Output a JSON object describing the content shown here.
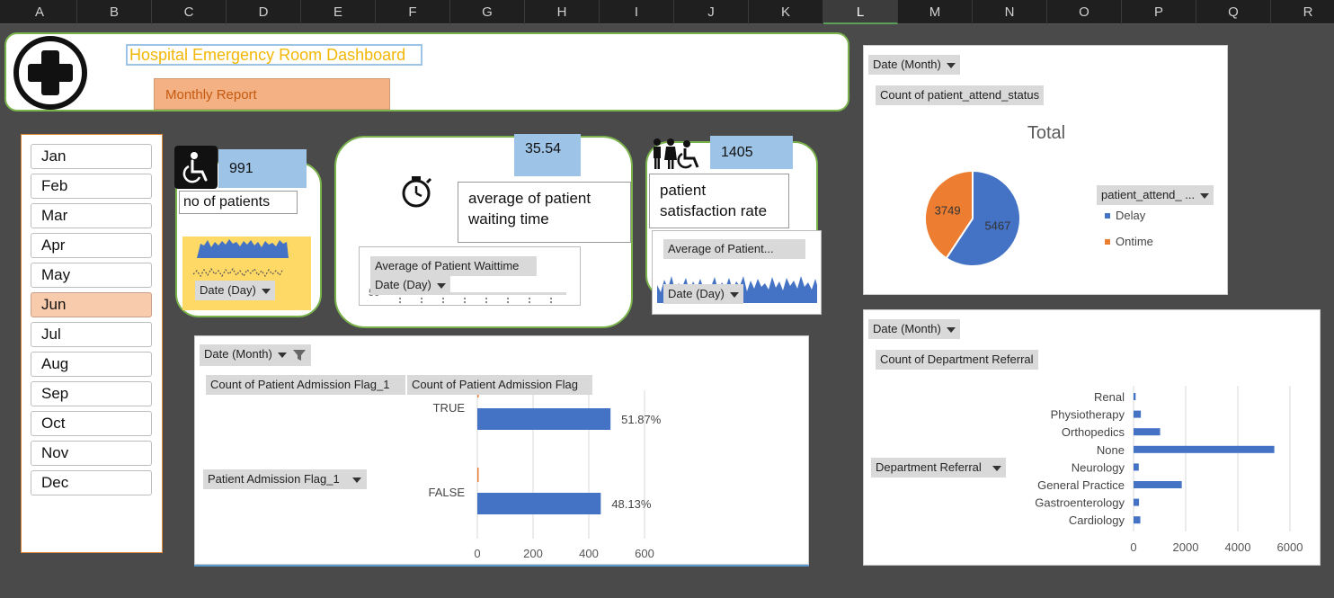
{
  "sheet": {
    "columns": [
      "A",
      "B",
      "C",
      "D",
      "E",
      "F",
      "G",
      "H",
      "I",
      "J",
      "K",
      "L",
      "M",
      "N",
      "O",
      "P",
      "Q",
      "R"
    ],
    "selected_column": "L"
  },
  "header": {
    "title": "Hospital Emergency Room Dashboard",
    "subtitle": "Monthly Report",
    "icon": "medical-cross-icon",
    "title_color": "#f2b705",
    "subtitle_bg": "#f4b183"
  },
  "slicer": {
    "months": [
      "Jan",
      "Feb",
      "Mar",
      "Apr",
      "May",
      "Jun",
      "Jul",
      "Aug",
      "Sep",
      "Oct",
      "Nov",
      "Dec"
    ],
    "selected": "Jun"
  },
  "kpis": {
    "patients": {
      "value": "991",
      "label": "no of patients",
      "filter": "Date (Day)",
      "icon": "wheelchair-icon"
    },
    "wait_time": {
      "value": "35.54",
      "label": "average of patient waiting time",
      "field": "Average of Patient Waittime",
      "filter": "Date (Day)",
      "axis_tick": "50",
      "icon": "stopwatch-icon"
    },
    "satisfaction": {
      "value": "1405",
      "label": "patient satisfaction rate",
      "field": "Average of Patient...",
      "filter": "Date (Day)",
      "icon": "people-icon"
    }
  },
  "attend_chart": {
    "filter": "Date (Month)",
    "field": "Count of patient_attend_status",
    "legend_filter": "patient_attend_ ...",
    "colors": {
      "Delay": "#4472c4",
      "Ontime": "#ed7d31"
    }
  },
  "admission_chart": {
    "filter": "Date (Month)",
    "field1": "Count of Patient Admission Flag_1",
    "field2": "Count of Patient Admission Flag",
    "row_filter": "Patient Admission Flag_1",
    "filter_icon": "funnel-icon"
  },
  "referral_chart": {
    "filter": "Date (Month)",
    "field": "Count of Department Referral",
    "row_filter": "Department Referral"
  },
  "chart_data": [
    {
      "type": "pie",
      "title": "Total",
      "categories": [
        "Delay",
        "Ontime"
      ],
      "values": [
        5467,
        3749
      ],
      "legend": "right"
    },
    {
      "type": "bar",
      "orientation": "horizontal",
      "categories": [
        "TRUE",
        "FALSE"
      ],
      "values": [
        478,
        443
      ],
      "data_labels": [
        "51.87%",
        "48.13%"
      ],
      "xlim": [
        0,
        600
      ],
      "xticks": [
        "0",
        "200",
        "400",
        "600"
      ],
      "grid": true
    },
    {
      "type": "bar",
      "orientation": "horizontal",
      "categories": [
        "Renal",
        "Physiotherapy",
        "Orthopedics",
        "None",
        "Neurology",
        "General Practice",
        "Gastroenterology",
        "Cardiology"
      ],
      "values": [
        80,
        280,
        1020,
        5400,
        200,
        1850,
        210,
        260
      ],
      "xlim": [
        0,
        6000
      ],
      "xticks": [
        "0",
        "2000",
        "4000",
        "6000"
      ],
      "grid": true
    }
  ]
}
